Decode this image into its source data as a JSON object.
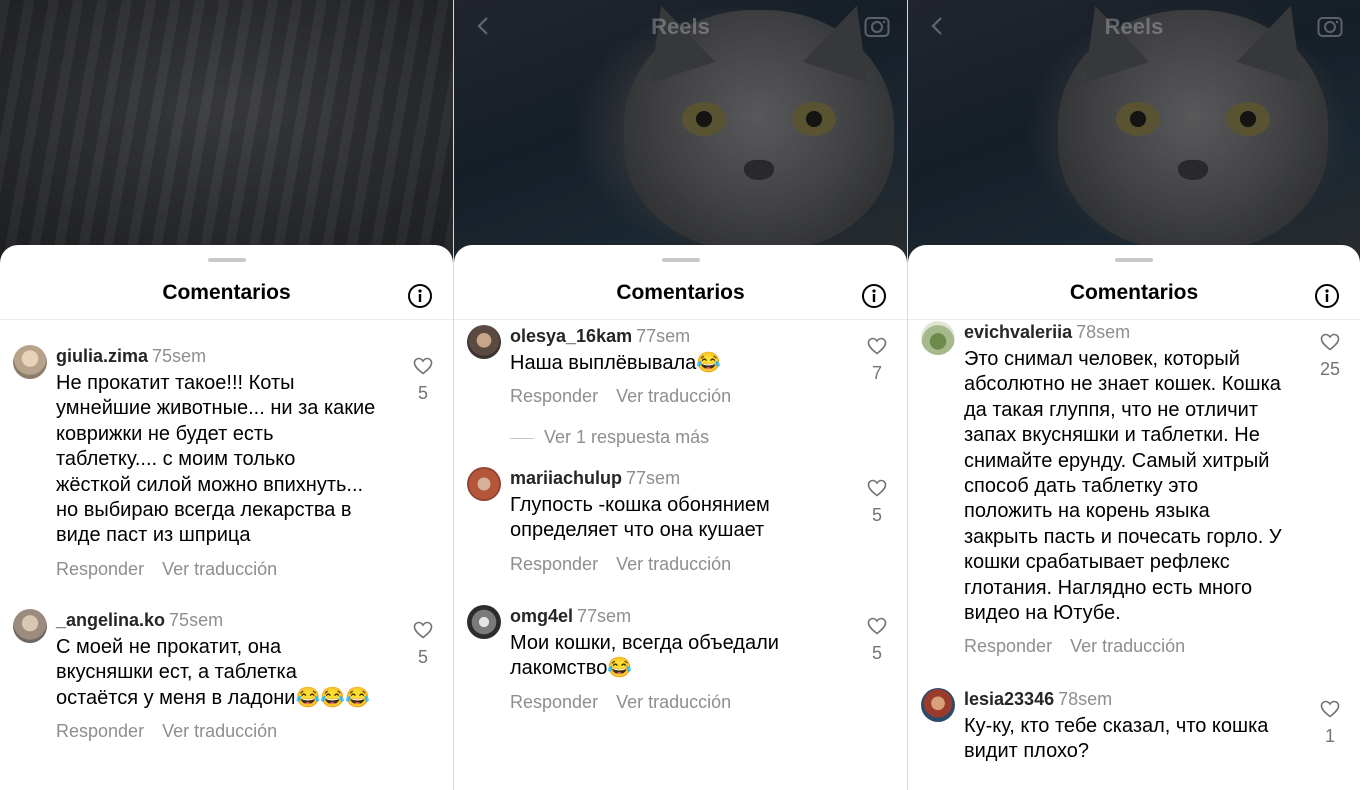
{
  "colors": {
    "username": "#262626",
    "meta": "#8e8e8e",
    "text": "#000000",
    "sheet": "#ffffff",
    "reels_overlay": "rgba(255,255,255,0.28)"
  },
  "icons": [
    "chevron-left-icon",
    "camera-icon",
    "info-icon",
    "heart-outline-icon"
  ],
  "panels": [
    {
      "reels_title": "",
      "sheet_title": "Comentarios",
      "comments": [
        {
          "user": "giulia.zima",
          "time": "75sem",
          "text": "Не прокатит такое!!! Коты\nумнейшие животные... ни за какие\nковрижки  не будет есть\nтаблетку.... с моим только\nжёсткой  силой можно впихнуть...\nно выбираю всегда  лекарства в\nвиде паст из шприца",
          "reply": "Responder",
          "translate": "Ver traducción",
          "likes": "5"
        },
        {
          "user": "_angelina.ko",
          "time": "75sem",
          "text": "С моей не прокатит, она\nвкусняшки ест, а таблетка\nостаётся у меня в ладони😂😂😂",
          "reply": "Responder",
          "translate": "Ver traducción",
          "likes": "5"
        }
      ]
    },
    {
      "reels_title": "Reels",
      "sheet_title": "Comentarios",
      "more_replies": "Ver 1 respuesta más",
      "comments": [
        {
          "user": "olesya_16kam",
          "time": "77sem",
          "text": "Наша выплёвывала😂",
          "reply": "Responder",
          "translate": "Ver traducción",
          "likes": "7"
        },
        {
          "user": "mariiachulup",
          "time": "77sem",
          "text": "Глупость -кошка обонянием\nопределяет что она кушает",
          "reply": "Responder",
          "translate": "Ver traducción",
          "likes": "5"
        },
        {
          "user": "omg4el",
          "time": "77sem",
          "text": "Мои кошки, всегда объедали\nлакомство😂",
          "reply": "Responder",
          "translate": "Ver traducción",
          "likes": "5"
        }
      ]
    },
    {
      "reels_title": "Reels",
      "sheet_title": "Comentarios",
      "comments": [
        {
          "user": "evichvaleriia",
          "time": "78sem",
          "text": "Это снимал человек, который\nабсолютно не знает кошек. Кошка\nда такая глуппя, что не отличит\nзапах вкусняшки и таблетки. Не\nснимайте ерунду. Самый хитрый\nспособ дать таблетку это\nположить на корень языка\nзакрыть пасть и почесать горло. У\nкошки срабатывает рефлекс\nглотания. Наглядно есть много\nвидео на Ютубе.",
          "reply": "Responder",
          "translate": "Ver traducción",
          "likes": "25"
        },
        {
          "user": "lesia23346",
          "time": "78sem",
          "text": "Ку-ку, кто тебе сказал, что кошка\nвидит плохо?",
          "reply": "",
          "translate": "",
          "likes": "1"
        }
      ]
    }
  ]
}
